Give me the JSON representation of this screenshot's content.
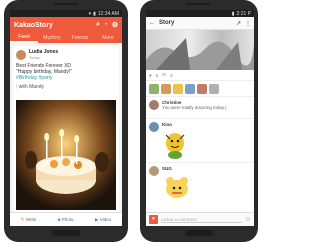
{
  "left": {
    "status_time": "12:34 AM",
    "app_title": "KakaoStory",
    "tabs": [
      {
        "label": "Feed",
        "active": true
      },
      {
        "label": "Mystory",
        "active": false
      },
      {
        "label": "Friends",
        "active": false
      },
      {
        "label": "More",
        "active": false
      }
    ],
    "post": {
      "author": "Ludia Jones",
      "time": "Today",
      "line1": "Best Friends Forever XD",
      "line2": "\"Happy birthday, Mandy!\"",
      "hashtags": "#Birthday #party",
      "mention": "with Mandy"
    },
    "bottom": {
      "write": "Write",
      "photo": "Photo",
      "video": "Video"
    },
    "accent": "#ef5a3c"
  },
  "right": {
    "status_time": "2:21 P",
    "header_title": "Story",
    "likes_count": "6",
    "comments_count": "3",
    "comments": [
      {
        "name": "Christine",
        "text": "You were totally amazing today.)"
      },
      {
        "name": "Kino",
        "text": ""
      },
      {
        "name": "SUG",
        "text": ""
      }
    ],
    "input_placeholder": "Leave a comment"
  }
}
